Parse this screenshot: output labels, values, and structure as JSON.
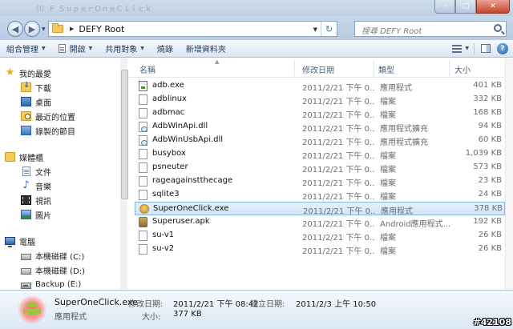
{
  "window": {
    "faded_title": "（I）Ｆ ＳｕｐｅｒＯｎｅＣｌｉｃｋ",
    "controls": {
      "minimize": "–",
      "maximize": "□",
      "close": "✕"
    }
  },
  "address": {
    "path": "DEFY Root",
    "search_placeholder": "搜尋 DEFY Root"
  },
  "toolbar": {
    "organize": "組合管理",
    "open": "開啟",
    "share": "共用對象",
    "burn": "燒錄",
    "new_folder": "新增資料夾"
  },
  "navigation": {
    "favorites": "我的最愛",
    "downloads": "下載",
    "desktop": "桌面",
    "recent": "最近的位置",
    "recorded_tv": "錄製的節目",
    "libraries": "媒體櫃",
    "documents": "文件",
    "music": "音樂",
    "videos": "視訊",
    "pictures": "圖片",
    "computer": "電腦",
    "drive_c": "本機磁碟 (C:)",
    "drive_d": "本機磁碟 (D:)",
    "drive_e": "Backup (E:)"
  },
  "columns": {
    "name": "名稱",
    "date": "修改日期",
    "type": "類型",
    "size": "大小"
  },
  "files": [
    {
      "name": "adb.exe",
      "date": "2011/2/21 下午 0...",
      "type": "應用程式",
      "size": "401 KB",
      "icon": "exe"
    },
    {
      "name": "adblinux",
      "date": "2011/2/21 下午 0...",
      "type": "檔案",
      "size": "332 KB",
      "icon": "file"
    },
    {
      "name": "adbmac",
      "date": "2011/2/21 下午 0...",
      "type": "檔案",
      "size": "168 KB",
      "icon": "file"
    },
    {
      "name": "AdbWinApi.dll",
      "date": "2011/2/21 下午 0...",
      "type": "應用程式擴充",
      "size": "94 KB",
      "icon": "dll"
    },
    {
      "name": "AdbWinUsbApi.dll",
      "date": "2011/2/21 下午 0...",
      "type": "應用程式擴充",
      "size": "60 KB",
      "icon": "dll"
    },
    {
      "name": "busybox",
      "date": "2011/2/21 下午 0...",
      "type": "檔案",
      "size": "1,039 KB",
      "icon": "file"
    },
    {
      "name": "psneuter",
      "date": "2011/2/21 下午 0...",
      "type": "檔案",
      "size": "573 KB",
      "icon": "file"
    },
    {
      "name": "rageagainstthecage",
      "date": "2011/2/21 下午 0...",
      "type": "檔案",
      "size": "23 KB",
      "icon": "file"
    },
    {
      "name": "sqlite3",
      "date": "2011/2/21 下午 0...",
      "type": "檔案",
      "size": "24 KB",
      "icon": "file"
    },
    {
      "name": "SuperOneClick.exe",
      "date": "2011/2/21 下午 0...",
      "type": "應用程式",
      "size": "378 KB",
      "icon": "soc",
      "selected": true
    },
    {
      "name": "Superuser.apk",
      "date": "2011/2/21 下午 0...",
      "type": "Android應用程式...",
      "size": "192 KB",
      "icon": "apk"
    },
    {
      "name": "su-v1",
      "date": "2011/2/21 下午 0...",
      "type": "檔案",
      "size": "26 KB",
      "icon": "file"
    },
    {
      "name": "su-v2",
      "date": "2011/2/21 下午 0...",
      "type": "檔案",
      "size": "26 KB",
      "icon": "file"
    }
  ],
  "details": {
    "name": "SuperOneClick.exe",
    "type": "應用程式",
    "modified_label": "修改日期:",
    "modified_value": "2011/2/21 下午 08:42",
    "created_label": "建立日期:",
    "created_value": "2011/2/3 上午 10:50",
    "size_label": "大小:",
    "size_value": "377 KB"
  },
  "watermark": "#42108"
}
